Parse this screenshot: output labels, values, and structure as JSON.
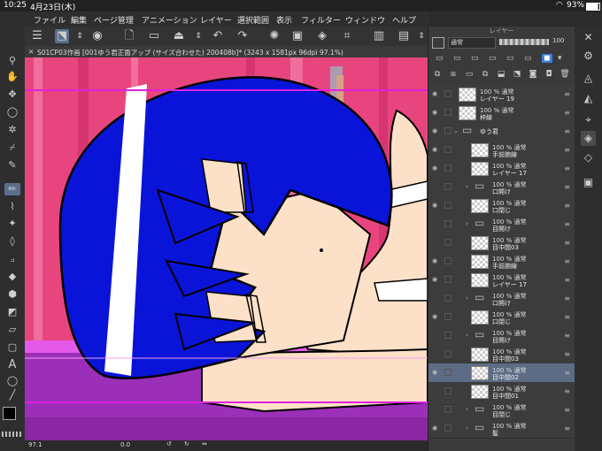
{
  "status": {
    "time": "10:25",
    "date": "4月23日(木)",
    "battery": "93%"
  },
  "menu": {
    "items": [
      "ファイル",
      "編集",
      "ページ管理",
      "アニメーション",
      "レイヤー",
      "選択範囲",
      "表示",
      "フィルター",
      "ウィンドウ",
      "ヘルプ"
    ]
  },
  "tab": {
    "title": "S01CP03作画 [001ゆう君正面アップ (サイズ合わせた) 200408b]* (3243 x 1581px 96dpi 97.1%)"
  },
  "bottom": {
    "zoom": "97.1",
    "angle": "0.0"
  },
  "layer_panel": {
    "title": "レイヤー",
    "blend_mode": "通常",
    "opacity": "100",
    "layers": [
      {
        "type": "layer",
        "line1": "100 % 通常",
        "line2": "レイヤー 19",
        "eye": true,
        "selected": false,
        "folder": false,
        "indent": 0
      },
      {
        "type": "layer",
        "line1": "100 % 通常",
        "line2": "枠線",
        "eye": true,
        "selected": false,
        "folder": false,
        "indent": 0
      },
      {
        "type": "folder",
        "line1": "",
        "line2": "ゆう君",
        "eye": true,
        "selected": false,
        "folder": true,
        "open": true,
        "indent": 0
      },
      {
        "type": "layer",
        "line1": "100 % 通常",
        "line2": "手前腕線",
        "eye": true,
        "selected": false,
        "folder": false,
        "indent": 1
      },
      {
        "type": "layer",
        "line1": "100 % 通常",
        "line2": "レイヤー 17",
        "eye": true,
        "selected": false,
        "folder": false,
        "indent": 1
      },
      {
        "type": "folder",
        "line1": "100 % 通常",
        "line2": "口開け",
        "eye": false,
        "selected": false,
        "folder": true,
        "open": false,
        "indent": 1
      },
      {
        "type": "layer",
        "line1": "100 % 通常",
        "line2": "口閉じ",
        "eye": true,
        "selected": false,
        "folder": false,
        "indent": 1
      },
      {
        "type": "folder",
        "line1": "100 % 通常",
        "line2": "目開け",
        "eye": false,
        "selected": false,
        "folder": true,
        "open": false,
        "indent": 1
      },
      {
        "type": "layer",
        "line1": "100 % 通常",
        "line2": "目中間03",
        "eye": false,
        "selected": false,
        "folder": false,
        "indent": 1
      },
      {
        "type": "layer",
        "line1": "100 % 通常",
        "line2": "手前腕線",
        "eye": true,
        "selected": false,
        "folder": false,
        "indent": 1
      },
      {
        "type": "layer",
        "line1": "100 % 通常",
        "line2": "レイヤー 17",
        "eye": true,
        "selected": false,
        "folder": false,
        "indent": 1
      },
      {
        "type": "folder",
        "line1": "100 % 通常",
        "line2": "口開け",
        "eye": false,
        "selected": false,
        "folder": true,
        "open": false,
        "indent": 1
      },
      {
        "type": "layer",
        "line1": "100 % 通常",
        "line2": "口閉じ",
        "eye": true,
        "selected": false,
        "folder": false,
        "indent": 1
      },
      {
        "type": "folder",
        "line1": "100 % 通常",
        "line2": "目開け",
        "eye": false,
        "selected": false,
        "folder": true,
        "open": false,
        "indent": 1
      },
      {
        "type": "layer",
        "line1": "100 % 通常",
        "line2": "目中間03",
        "eye": false,
        "selected": false,
        "folder": false,
        "indent": 1
      },
      {
        "type": "layer",
        "line1": "100 % 通常",
        "line2": "目中間02",
        "eye": true,
        "selected": true,
        "folder": false,
        "indent": 1
      },
      {
        "type": "layer",
        "line1": "100 % 通常",
        "line2": "目中間01",
        "eye": false,
        "selected": false,
        "folder": false,
        "indent": 1
      },
      {
        "type": "folder",
        "line1": "100 % 通常",
        "line2": "目閉じ",
        "eye": false,
        "selected": false,
        "folder": true,
        "open": false,
        "indent": 1
      },
      {
        "type": "folder",
        "line1": "100 % 通常",
        "line2": "髪",
        "eye": true,
        "selected": false,
        "folder": true,
        "open": false,
        "indent": 1
      }
    ]
  },
  "colors": {
    "hair": "#0a14d8",
    "skin": "#fde0c8",
    "bg_pink": "#e8457e",
    "floor": "#9b2fb8",
    "guide": "#e020e0",
    "selected": "#5d6c85"
  }
}
